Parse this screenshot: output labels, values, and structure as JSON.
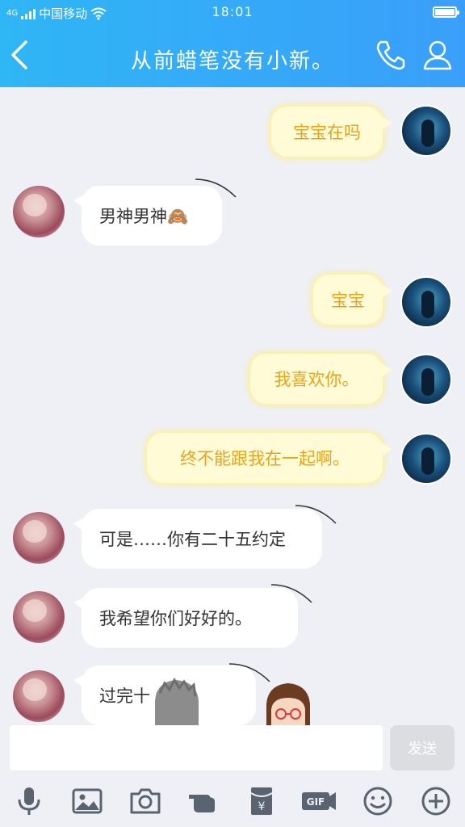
{
  "status": {
    "network": "4G",
    "carrier": "中国移动",
    "time": "18:01"
  },
  "header": {
    "title": "从前蜡笔没有小新。"
  },
  "messages": [
    {
      "side": "out",
      "text": "宝宝在吗"
    },
    {
      "side": "in",
      "text": "男神男神🙈"
    },
    {
      "side": "out",
      "text": "宝宝"
    },
    {
      "side": "out",
      "text": "我喜欢你。"
    },
    {
      "side": "out",
      "text": "终不能跟我在一起啊。"
    },
    {
      "side": "in",
      "text": "可是……你有二十五约定"
    },
    {
      "side": "in",
      "text": "我希望你们好好的。"
    },
    {
      "side": "in",
      "text": "过完十 约。"
    }
  ],
  "composer": {
    "value": "",
    "send_label": "发送"
  },
  "toolbar": [
    "microphone-icon",
    "image-icon",
    "camera-icon",
    "pointing-hand-icon",
    "red-packet-icon",
    "gif-icon",
    "emoji-icon",
    "plus-icon"
  ],
  "colors": {
    "header": "#35a9f8",
    "out_text": "#e8a31c",
    "out_bubble": "#fffbd6",
    "in_bubble": "#ffffff"
  }
}
